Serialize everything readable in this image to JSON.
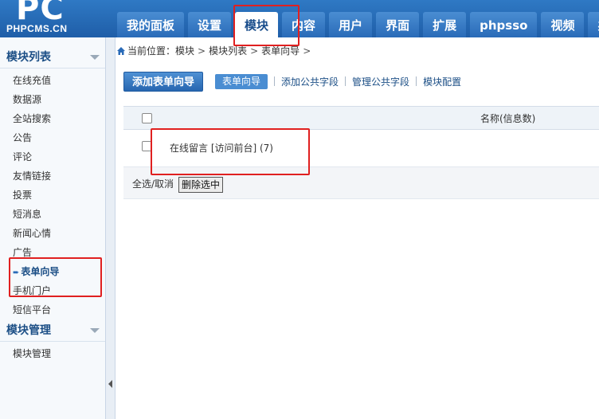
{
  "logo": {
    "letters": "PC",
    "subtitle": "PHPCMS.CN"
  },
  "nav": {
    "tabs": [
      {
        "label": "我的面板",
        "active": false
      },
      {
        "label": "设置",
        "active": false
      },
      {
        "label": "模块",
        "active": true
      },
      {
        "label": "内容",
        "active": false
      },
      {
        "label": "用户",
        "active": false
      },
      {
        "label": "界面",
        "active": false
      },
      {
        "label": "扩展",
        "active": false
      },
      {
        "label": "phpsso",
        "active": false
      },
      {
        "label": "视频",
        "active": false
      },
      {
        "label": "办",
        "active": false
      }
    ]
  },
  "sidebar": {
    "section1_title": "模块列表",
    "items": [
      "在线充值",
      "数据源",
      "全站搜索",
      "公告",
      "评论",
      "友情链接",
      "投票",
      "短消息",
      "新闻心情",
      "广告",
      "表单向导",
      "手机门户",
      "短信平台"
    ],
    "active_item": "表单向导",
    "section2_title": "模块管理",
    "items2": [
      "模块管理"
    ]
  },
  "breadcrumb": {
    "label": "当前位置：",
    "path": [
      "模块",
      "模块列表",
      "表单向导"
    ],
    "separator": ">"
  },
  "toolbar": {
    "add_button": "添加表单向导",
    "current_tab": "表单向导",
    "links": [
      "添加公共字段",
      "管理公共字段",
      "模块配置"
    ]
  },
  "table": {
    "header_name": "名称(信息数)",
    "rows": [
      {
        "name": "在线留言 [访问前台] (7)"
      }
    ],
    "footer_select": "全选/取消",
    "footer_delete": "删除选中"
  },
  "colors": {
    "header_blue": "#2f79c4",
    "link_blue": "#1c4f86",
    "annotation_red": "#e02020"
  }
}
